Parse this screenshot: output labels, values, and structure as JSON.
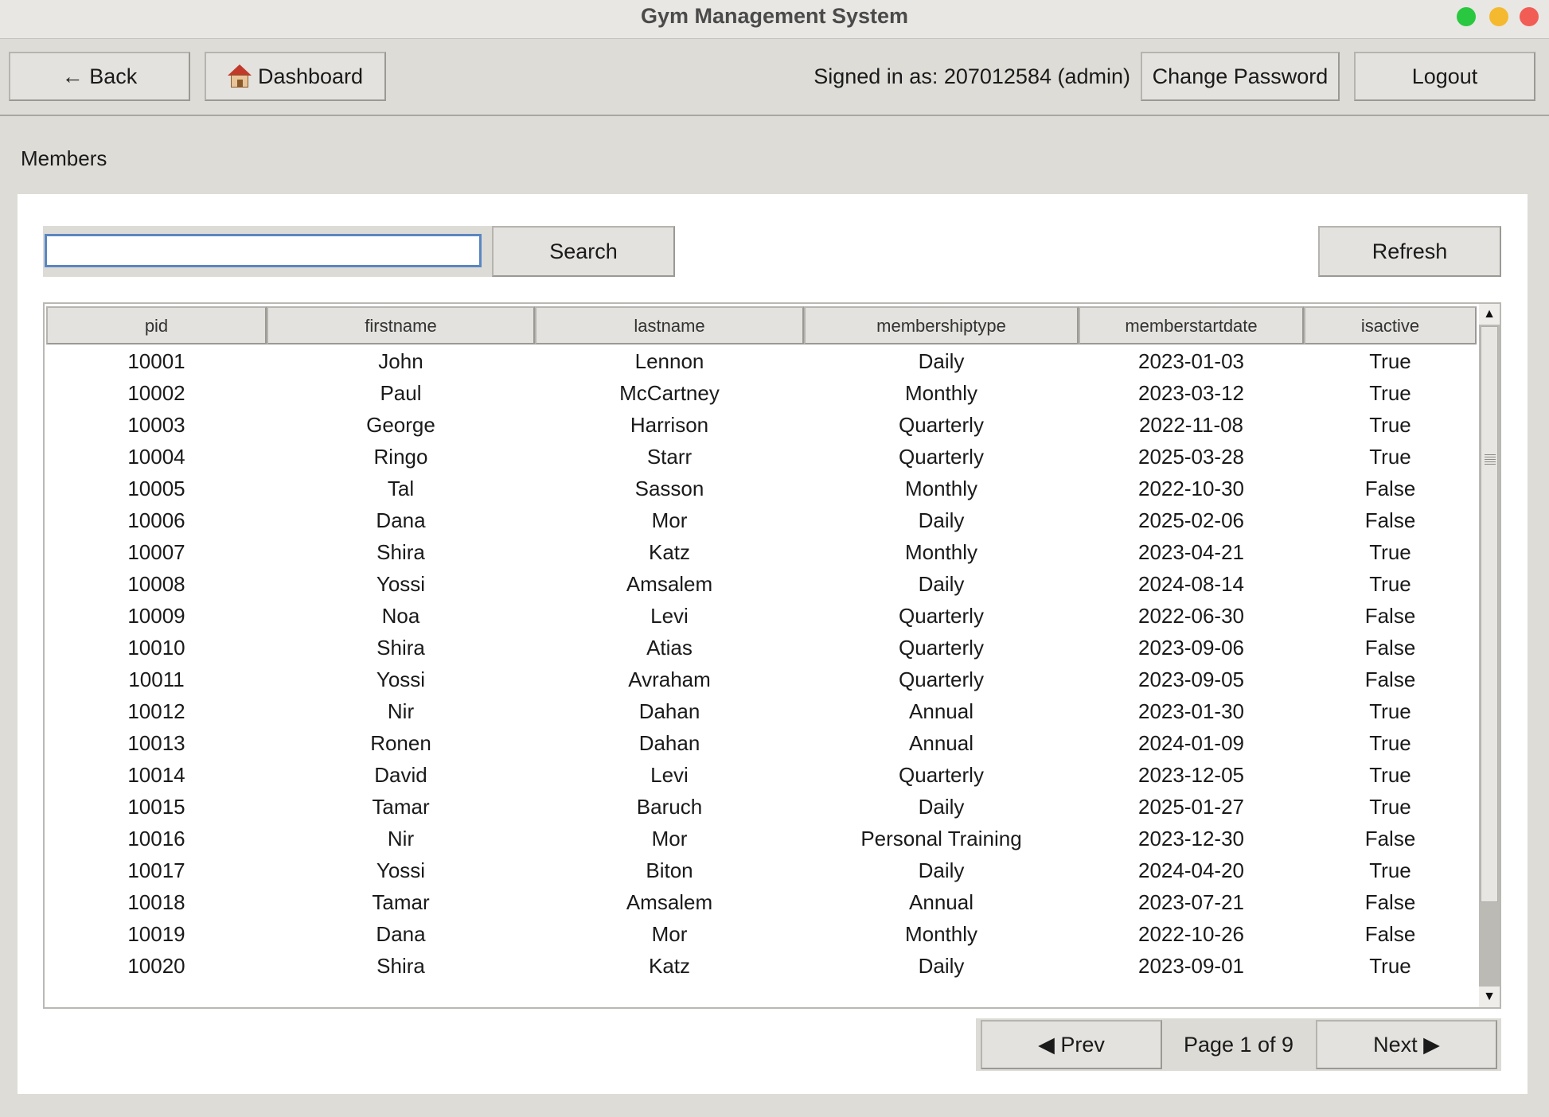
{
  "window": {
    "title": "Gym Management System"
  },
  "toolbar": {
    "back_label": "← Back",
    "dashboard_label": "Dashboard",
    "signed_in_text": "Signed in as: 207012584 (admin)",
    "change_password_label": "Change Password",
    "logout_label": "Logout"
  },
  "section": {
    "title": "Members"
  },
  "search": {
    "value": "",
    "button_label": "Search",
    "refresh_label": "Refresh"
  },
  "table": {
    "columns": [
      "pid",
      "firstname",
      "lastname",
      "membershiptype",
      "memberstartdate",
      "isactive"
    ],
    "rows": [
      [
        "10001",
        "John",
        "Lennon",
        "Daily",
        "2023-01-03",
        "True"
      ],
      [
        "10002",
        "Paul",
        "McCartney",
        "Monthly",
        "2023-03-12",
        "True"
      ],
      [
        "10003",
        "George",
        "Harrison",
        "Quarterly",
        "2022-11-08",
        "True"
      ],
      [
        "10004",
        "Ringo",
        "Starr",
        "Quarterly",
        "2025-03-28",
        "True"
      ],
      [
        "10005",
        "Tal",
        "Sasson",
        "Monthly",
        "2022-10-30",
        "False"
      ],
      [
        "10006",
        "Dana",
        "Mor",
        "Daily",
        "2025-02-06",
        "False"
      ],
      [
        "10007",
        "Shira",
        "Katz",
        "Monthly",
        "2023-04-21",
        "True"
      ],
      [
        "10008",
        "Yossi",
        "Amsalem",
        "Daily",
        "2024-08-14",
        "True"
      ],
      [
        "10009",
        "Noa",
        "Levi",
        "Quarterly",
        "2022-06-30",
        "False"
      ],
      [
        "10010",
        "Shira",
        "Atias",
        "Quarterly",
        "2023-09-06",
        "False"
      ],
      [
        "10011",
        "Yossi",
        "Avraham",
        "Quarterly",
        "2023-09-05",
        "False"
      ],
      [
        "10012",
        "Nir",
        "Dahan",
        "Annual",
        "2023-01-30",
        "True"
      ],
      [
        "10013",
        "Ronen",
        "Dahan",
        "Annual",
        "2024-01-09",
        "True"
      ],
      [
        "10014",
        "David",
        "Levi",
        "Quarterly",
        "2023-12-05",
        "True"
      ],
      [
        "10015",
        "Tamar",
        "Baruch",
        "Daily",
        "2025-01-27",
        "True"
      ],
      [
        "10016",
        "Nir",
        "Mor",
        "Personal Training",
        "2023-12-30",
        "False"
      ],
      [
        "10017",
        "Yossi",
        "Biton",
        "Daily",
        "2024-04-20",
        "True"
      ],
      [
        "10018",
        "Tamar",
        "Amsalem",
        "Annual",
        "2023-07-21",
        "False"
      ],
      [
        "10019",
        "Dana",
        "Mor",
        "Monthly",
        "2022-10-26",
        "False"
      ],
      [
        "10020",
        "Shira",
        "Katz",
        "Daily",
        "2023-09-01",
        "True"
      ]
    ]
  },
  "pager": {
    "prev_label": "◀ Prev",
    "page_text": "Page 1 of 9",
    "next_label": "Next ▶"
  },
  "icons": {
    "dashboard": "house-icon",
    "scroll_up": "arrow-up-icon",
    "scroll_down": "arrow-down-icon"
  },
  "colors": {
    "traffic_green": "#2ac840",
    "traffic_yellow": "#f5b92f",
    "traffic_red": "#f15d55",
    "input_focus": "#5a86c2"
  }
}
